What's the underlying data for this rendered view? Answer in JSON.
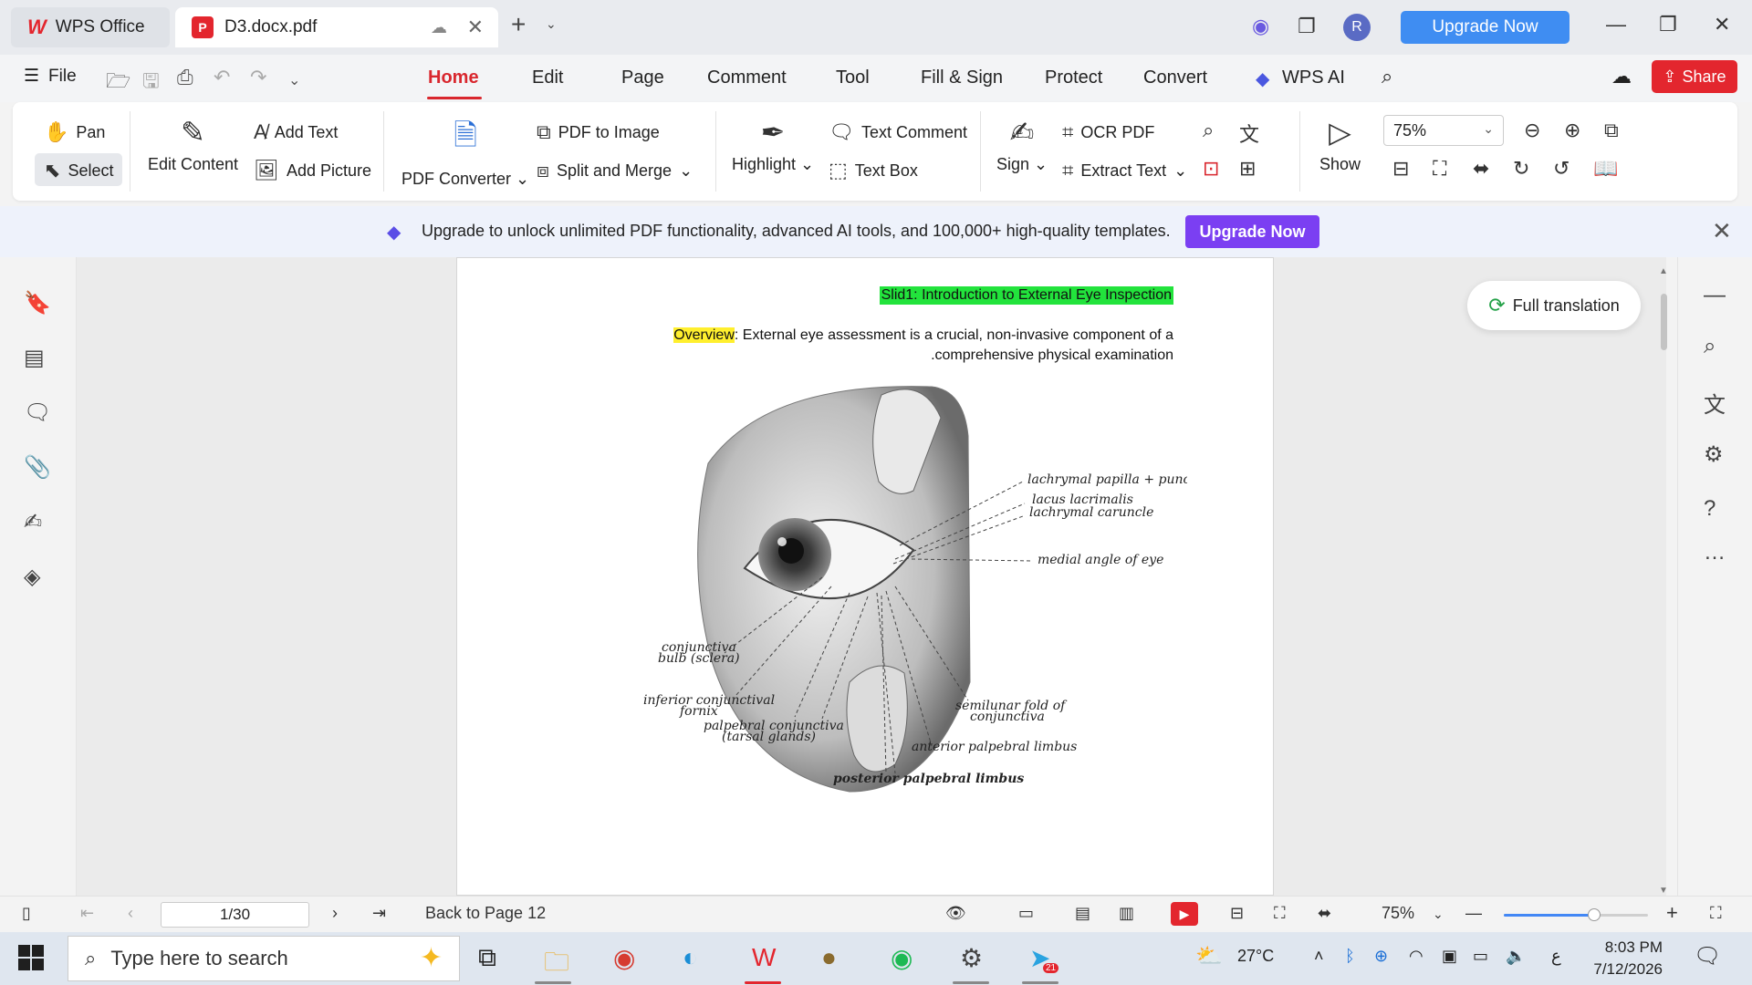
{
  "titlebar": {
    "app_tab": "WPS Office",
    "doc_tab": "D3.docx.pdf",
    "avatar_initial": "R",
    "upgrade_label": "Upgrade Now"
  },
  "menubar": {
    "file_label": "File",
    "items": [
      "Home",
      "Edit",
      "Page",
      "Comment",
      "Tool",
      "Fill & Sign",
      "Protect",
      "Convert",
      "WPS AI"
    ],
    "active": "Home",
    "share_label": "Share"
  },
  "ribbon": {
    "pan": "Pan",
    "select": "Select",
    "edit_content": "Edit Content",
    "add_text": "Add Text",
    "add_picture": "Add Picture",
    "pdf_converter": "PDF Converter",
    "pdf_to_image": "PDF to Image",
    "split_merge": "Split and Merge",
    "highlight": "Highlight",
    "text_comment": "Text Comment",
    "text_box": "Text Box",
    "sign": "Sign",
    "ocr_pdf": "OCR PDF",
    "extract_text": "Extract Text",
    "show": "Show",
    "zoom_value": "75%"
  },
  "banner": {
    "text": "Upgrade to unlock unlimited PDF functionality, advanced AI tools, and 100,000+ high-quality templates.",
    "button": "Upgrade Now"
  },
  "document": {
    "slide_title": "Slid1: Introduction to External Eye Inspection",
    "overview_label": "Overview",
    "overview_line1": ": External eye assessment is a crucial, non-invasive component of a",
    "overview_line2": ".comprehensive physical examination",
    "figure_labels": {
      "papilla": "lachrymal papilla + punctum",
      "lacus": "lacus lacrimalis",
      "caruncle": "lachrymal caruncle",
      "medial": "medial angle of eye",
      "conj_bulb_1": "conjunctiva",
      "conj_bulb_2": "bulb (sclera)",
      "fornix_1": "inferior conjunctival",
      "fornix_2": "fornix",
      "palp_conj_1": "palpebral conjunctiva",
      "palp_conj_2": "(tarsal glands)",
      "semilunar_1": "semilunar fold of",
      "semilunar_2": "conjunctiva",
      "ant_limbus": "anterior palpebral limbus",
      "post_limbus": "posterior palpebral limbus"
    }
  },
  "full_translation": "Full translation",
  "statusbar": {
    "page_indicator": "1/30",
    "back_to_page": "Back to Page 12",
    "zoom": "75%",
    "zoom_level": 0.75
  },
  "taskbar": {
    "search_placeholder": "Type here to search",
    "temperature": "27°C",
    "time": "8:03 PM",
    "date": "7/12/2026",
    "lang": "ع",
    "telegram_badge": "21"
  }
}
